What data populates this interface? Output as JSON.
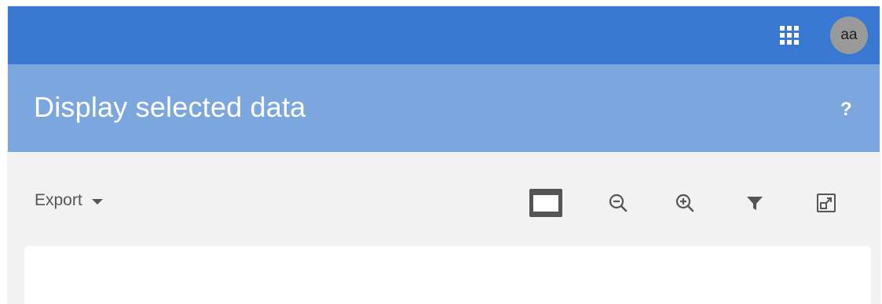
{
  "header": {
    "apps_icon": "apps-grid-icon",
    "avatar_initials": "aa"
  },
  "title_bar": {
    "title": "Display selected data",
    "help_label": "?"
  },
  "toolbar": {
    "export_label": "Export",
    "tools": [
      {
        "name": "display-mode-button",
        "icon": "monitor-icon"
      },
      {
        "name": "zoom-out-button",
        "icon": "zoom-out-icon"
      },
      {
        "name": "zoom-in-button",
        "icon": "zoom-in-icon"
      },
      {
        "name": "filter-button",
        "icon": "filter-icon"
      },
      {
        "name": "expand-button",
        "icon": "expand-icon"
      }
    ]
  },
  "colors": {
    "topbar": "#3878d2",
    "titlebar": "#7ba7de",
    "background": "#f2f2f2",
    "icon": "#555555"
  }
}
